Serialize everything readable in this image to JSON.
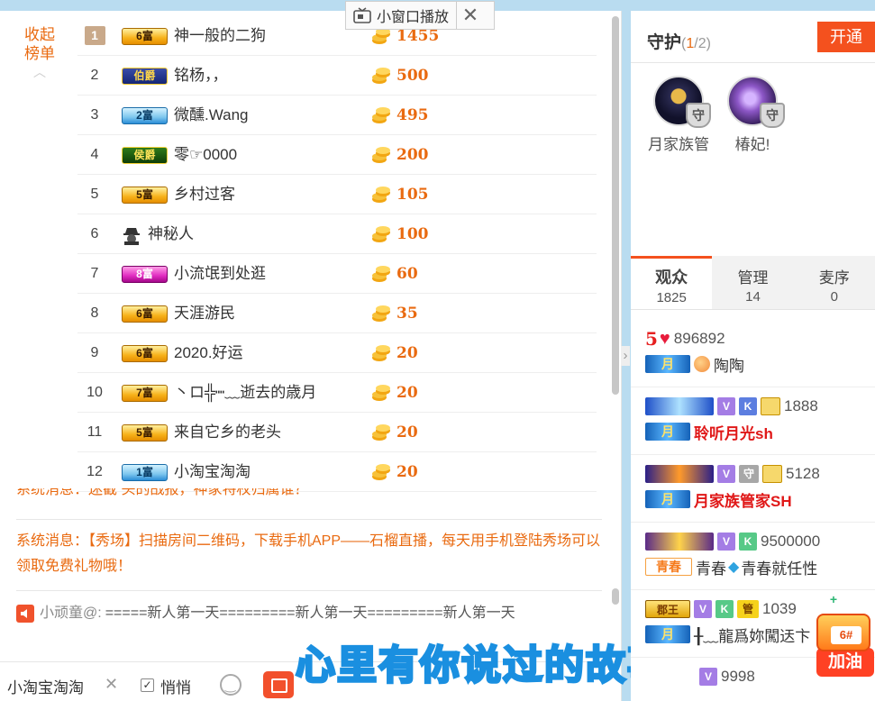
{
  "mini_player": {
    "label": "小窗口播放",
    "close": "✕"
  },
  "ranking": {
    "collapse_label_1": "收起",
    "collapse_label_2": "榜单",
    "collapse_chevron": "︿",
    "rows": [
      {
        "rank": "1",
        "badge": "6富",
        "name": "神一般的二狗",
        "value": "1455"
      },
      {
        "rank": "2",
        "badge": "伯爵",
        "name": "铭杨，，",
        "value": "500"
      },
      {
        "rank": "3",
        "badge": "2富",
        "name": "微醺.Wang",
        "value": "495"
      },
      {
        "rank": "4",
        "badge": "侯爵",
        "name": "零☞0000",
        "value": "200"
      },
      {
        "rank": "5",
        "badge": "5富",
        "name": "乡村过客",
        "value": "105"
      },
      {
        "rank": "6",
        "badge": "",
        "name": "神秘人",
        "value": "100"
      },
      {
        "rank": "7",
        "badge": "8富",
        "name": "小流氓到处逛",
        "value": "60"
      },
      {
        "rank": "8",
        "badge": "6富",
        "name": "天涯游民",
        "value": "35"
      },
      {
        "rank": "9",
        "badge": "6富",
        "name": "2020.好运",
        "value": "20"
      },
      {
        "rank": "10",
        "badge": "7富",
        "name": "丶ロ╬┉﹏逝去的歳月",
        "value": "20"
      },
      {
        "rank": "11",
        "badge": "5富",
        "name": "来自它乡的老头",
        "value": "20"
      },
      {
        "rank": "12",
        "badge": "1富",
        "name": "小淘宝淘淘",
        "value": "20"
      }
    ]
  },
  "messages": {
    "partial": "系统消息：迷截 头的战报，神家特权归属谁？",
    "system": "系统消息：【秀场】扫描房间二维码，下载手机APP——石榴直播，每天用手机登陆秀场可以领取免费礼物哦！",
    "chat_user": "小顽童@:",
    "chat_text": "=====新人第一天=========新人第一天=========新人第一天"
  },
  "chatbar": {
    "target": "小淘宝淘淘",
    "remove": "✕",
    "whisper_label": "悄悄",
    "whisper_checked": "✓"
  },
  "subtitle": "心里有你说过的故事",
  "guard": {
    "title": "守护",
    "count_current": "1",
    "count_total": "/2",
    "open_button": "开通",
    "shield_char": "守",
    "members": [
      {
        "name": "月家族管"
      },
      {
        "name": "椿妃!"
      }
    ]
  },
  "tabs": [
    {
      "label": "观众",
      "count": "1825",
      "active": true
    },
    {
      "label": "管理",
      "count": "14",
      "active": false
    },
    {
      "label": "麦序",
      "count": "0",
      "active": false
    }
  ],
  "audience": [
    {
      "level": "5",
      "id": "896892",
      "tag": "月",
      "name": "陶陶"
    },
    {
      "tags": [
        "V",
        "K"
      ],
      "id": "1888",
      "tag": "月",
      "name": "聆听月光sh"
    },
    {
      "tags": [
        "V",
        "守"
      ],
      "id": "5128",
      "tag": "月",
      "name": "月家族管家SH"
    },
    {
      "tags": [
        "V",
        "K"
      ],
      "id": "9500000",
      "tag": "青春",
      "name": "青春",
      "name2": "青春就任性"
    },
    {
      "badge": "郡王",
      "tags": [
        "V",
        "K",
        "管"
      ],
      "id": "1039",
      "tag": "月",
      "name": "╂﹏龍爲妳闖迗卞"
    },
    {
      "tags": [
        "V"
      ],
      "id": "9998"
    }
  ],
  "pin_widget": {
    "badge": "6#",
    "label": "加油"
  },
  "colors": {
    "accent": "#e96a10",
    "button": "#f4511e",
    "subtitle_stroke": "#1a8fe0"
  }
}
